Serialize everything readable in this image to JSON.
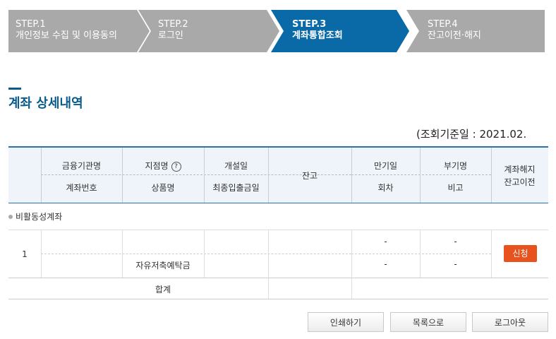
{
  "steps": [
    {
      "num": "STEP.1",
      "label": "개인정보 수집 및 이용동의",
      "active": false
    },
    {
      "num": "STEP.2",
      "label": "로그인",
      "active": false
    },
    {
      "num": "STEP.3",
      "label": "계좌통합조회",
      "active": true
    },
    {
      "num": "STEP.4",
      "label": "잔고이전·해지",
      "active": false
    }
  ],
  "colors": {
    "step_inactive": "#a9a9a9",
    "step_active": "#0a6aa8",
    "apply": "#e8521f",
    "title": "#0a5a8c"
  },
  "page_title": "계좌 상세내역",
  "ref_date": "(조회기준일 : 2021.02.",
  "table": {
    "headers": {
      "institution": "금융기관명",
      "account_no": "계좌번호",
      "branch": "지점명",
      "help_icon": "?",
      "product": "상품명",
      "opened": "개설일",
      "last_txn": "최종입출금일",
      "balance": "잔고",
      "maturity": "만기일",
      "round": "회차",
      "sub_name": "부기명",
      "note": "비고",
      "close_1": "계좌해지",
      "close_2": "잔고이전"
    },
    "group_label": "비활동성계좌",
    "row": {
      "index": "1",
      "product": "자유저축예탁금",
      "maturity": "-",
      "sub_name": "-",
      "round": "-",
      "note": "-",
      "apply_label": "신청"
    },
    "total_label": "합계"
  },
  "buttons": {
    "print": "인쇄하기",
    "list": "목록으로",
    "logout": "로그아웃"
  }
}
